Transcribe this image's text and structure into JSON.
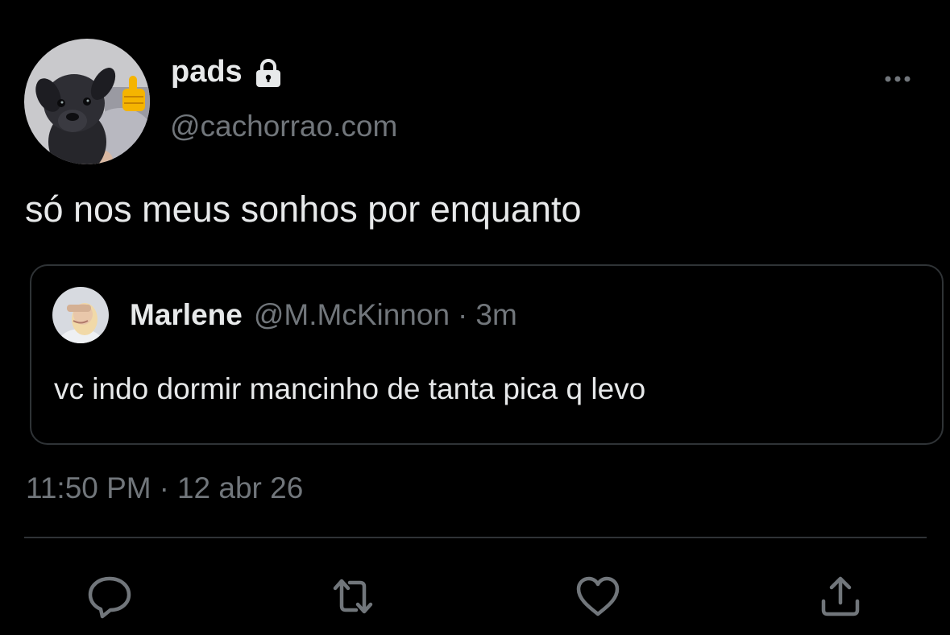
{
  "tweet": {
    "author_name": "pads",
    "author_handle": "@cachorrao.com",
    "text": "só nos meus sonhos por enquanto",
    "time": "11:50 PM",
    "separator": "·",
    "date": "12 abr 26"
  },
  "quote": {
    "author_name": "Marlene",
    "author_handle": "@M.McKinnon",
    "separator": "·",
    "age": "3m",
    "text": "vc indo dormir mancinho de tanta pica q levo"
  },
  "icons": {
    "lock": "lock-icon",
    "more": "more-icon",
    "reply": "reply-icon",
    "retweet": "retweet-icon",
    "like": "heart-icon",
    "share": "share-icon"
  },
  "colors": {
    "background": "#000000",
    "text": "#e7e9ea",
    "secondary": "#71767b",
    "border": "#2f3336"
  }
}
